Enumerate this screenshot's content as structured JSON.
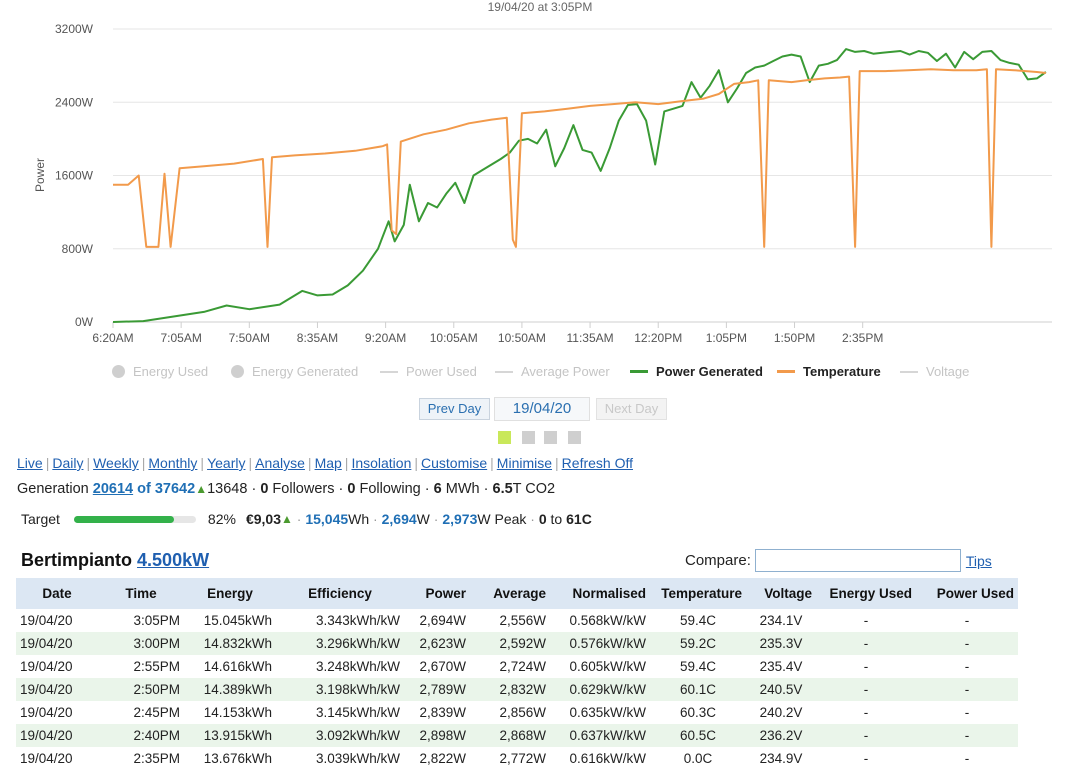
{
  "chart_data": {
    "type": "line",
    "title": "19/04/20 at 3:05PM",
    "ylabel": "Power",
    "ylim": [
      0,
      3200
    ],
    "yticks": [
      "0W",
      "800W",
      "1600W",
      "2400W",
      "3200W"
    ],
    "xticks": [
      "6:20AM",
      "7:05AM",
      "7:50AM",
      "8:35AM",
      "9:20AM",
      "10:05AM",
      "10:50AM",
      "11:35AM",
      "12:20PM",
      "1:05PM",
      "1:50PM",
      "2:35PM"
    ],
    "x_unit": "minutes after midnight",
    "grid": "horizontal",
    "legend_position": "bottom",
    "series": [
      {
        "name": "Power Generated",
        "color": "#3a9a35",
        "points": [
          [
            380,
            0
          ],
          [
            400,
            10
          ],
          [
            420,
            60
          ],
          [
            440,
            110
          ],
          [
            455,
            180
          ],
          [
            470,
            140
          ],
          [
            490,
            190
          ],
          [
            505,
            340
          ],
          [
            515,
            290
          ],
          [
            525,
            300
          ],
          [
            535,
            400
          ],
          [
            545,
            560
          ],
          [
            555,
            800
          ],
          [
            562,
            1100
          ],
          [
            566,
            880
          ],
          [
            572,
            1060
          ],
          [
            576,
            1500
          ],
          [
            582,
            1100
          ],
          [
            588,
            1300
          ],
          [
            594,
            1250
          ],
          [
            600,
            1400
          ],
          [
            606,
            1520
          ],
          [
            612,
            1300
          ],
          [
            618,
            1600
          ],
          [
            624,
            1660
          ],
          [
            630,
            1720
          ],
          [
            636,
            1780
          ],
          [
            642,
            1850
          ],
          [
            648,
            1980
          ],
          [
            654,
            2000
          ],
          [
            660,
            1950
          ],
          [
            666,
            2100
          ],
          [
            672,
            1700
          ],
          [
            678,
            1900
          ],
          [
            684,
            2150
          ],
          [
            690,
            1880
          ],
          [
            696,
            1850
          ],
          [
            702,
            1650
          ],
          [
            708,
            1900
          ],
          [
            714,
            2200
          ],
          [
            720,
            2370
          ],
          [
            726,
            2380
          ],
          [
            732,
            2200
          ],
          [
            738,
            1720
          ],
          [
            744,
            2300
          ],
          [
            750,
            2330
          ],
          [
            756,
            2360
          ],
          [
            762,
            2620
          ],
          [
            768,
            2450
          ],
          [
            774,
            2580
          ],
          [
            780,
            2750
          ],
          [
            786,
            2400
          ],
          [
            792,
            2550
          ],
          [
            798,
            2720
          ],
          [
            804,
            2780
          ],
          [
            810,
            2800
          ],
          [
            816,
            2850
          ],
          [
            822,
            2900
          ],
          [
            828,
            2920
          ],
          [
            834,
            2900
          ],
          [
            840,
            2620
          ],
          [
            846,
            2800
          ],
          [
            852,
            2820
          ],
          [
            858,
            2860
          ],
          [
            864,
            2980
          ],
          [
            870,
            2950
          ],
          [
            876,
            2960
          ],
          [
            882,
            2930
          ],
          [
            888,
            2940
          ],
          [
            894,
            2950
          ],
          [
            900,
            2960
          ],
          [
            906,
            2920
          ],
          [
            912,
            2960
          ],
          [
            918,
            2940
          ],
          [
            924,
            2850
          ],
          [
            930,
            2930
          ],
          [
            936,
            2780
          ],
          [
            942,
            2950
          ],
          [
            948,
            2870
          ],
          [
            954,
            2950
          ],
          [
            960,
            2960
          ],
          [
            966,
            2860
          ],
          [
            972,
            2830
          ],
          [
            978,
            2810
          ],
          [
            984,
            2650
          ],
          [
            990,
            2660
          ],
          [
            996,
            2730
          ]
        ]
      },
      {
        "name": "Temperature",
        "color": "#f29a4b",
        "points": [
          [
            380,
            1500
          ],
          [
            390,
            1500
          ],
          [
            397,
            1600
          ],
          [
            402,
            820
          ],
          [
            410,
            820
          ],
          [
            414,
            1620
          ],
          [
            418,
            820
          ],
          [
            424,
            1680
          ],
          [
            440,
            1700
          ],
          [
            460,
            1730
          ],
          [
            479,
            1780
          ],
          [
            482,
            820
          ],
          [
            485,
            1800
          ],
          [
            500,
            1820
          ],
          [
            520,
            1840
          ],
          [
            540,
            1870
          ],
          [
            558,
            1920
          ],
          [
            561,
            1940
          ],
          [
            564,
            1000
          ],
          [
            567,
            960
          ],
          [
            570,
            1970
          ],
          [
            585,
            2050
          ],
          [
            600,
            2100
          ],
          [
            615,
            2170
          ],
          [
            630,
            2210
          ],
          [
            640,
            2230
          ],
          [
            644,
            900
          ],
          [
            646,
            820
          ],
          [
            650,
            2280
          ],
          [
            665,
            2300
          ],
          [
            680,
            2330
          ],
          [
            695,
            2360
          ],
          [
            710,
            2380
          ],
          [
            725,
            2400
          ],
          [
            740,
            2380
          ],
          [
            755,
            2410
          ],
          [
            770,
            2440
          ],
          [
            780,
            2490
          ],
          [
            790,
            2600
          ],
          [
            800,
            2620
          ],
          [
            806,
            2640
          ],
          [
            810,
            820
          ],
          [
            813,
            2640
          ],
          [
            828,
            2620
          ],
          [
            838,
            2640
          ],
          [
            850,
            2660
          ],
          [
            860,
            2670
          ],
          [
            866,
            2680
          ],
          [
            870,
            820
          ],
          [
            873,
            2740
          ],
          [
            890,
            2740
          ],
          [
            905,
            2750
          ],
          [
            920,
            2760
          ],
          [
            935,
            2750
          ],
          [
            950,
            2750
          ],
          [
            957,
            2760
          ],
          [
            960,
            820
          ],
          [
            963,
            2760
          ],
          [
            975,
            2750
          ],
          [
            990,
            2730
          ],
          [
            996,
            2720
          ]
        ]
      }
    ]
  },
  "legend": [
    {
      "label": "Energy Used",
      "kind": "dot",
      "enabled": false
    },
    {
      "label": "Energy Generated",
      "kind": "dot",
      "enabled": false
    },
    {
      "label": "Power Used",
      "kind": "line",
      "enabled": false
    },
    {
      "label": "Average Power",
      "kind": "line",
      "enabled": false
    },
    {
      "label": "Power Generated",
      "kind": "line",
      "enabled": true,
      "color": "#3a9a35"
    },
    {
      "label": "Temperature",
      "kind": "line",
      "enabled": true,
      "color": "#f29a4b"
    },
    {
      "label": "Voltage",
      "kind": "line",
      "enabled": false
    }
  ],
  "daynav": {
    "prev": "Prev Day",
    "date": "19/04/20",
    "next": "Next Day"
  },
  "nav_links": [
    "Live",
    "Daily",
    "Weekly",
    "Monthly",
    "Yearly",
    "Analyse",
    "Map",
    "Insolation",
    "Customise",
    "Minimise",
    "Refresh Off"
  ],
  "generation": {
    "label": "Generation",
    "rank": "20614",
    "rank_of": "of 37642",
    "rank_change": "13648",
    "followers": "0",
    "followers_label": "Followers",
    "following": "0",
    "following_label": "Following",
    "energy": "6",
    "energy_unit": "MWh",
    "co2": "6.5",
    "co2_unit": "T CO2"
  },
  "target": {
    "label": "Target",
    "percent_value": 82,
    "percent": "82%",
    "money": "€9,03",
    "energy": "15,045",
    "energy_unit": "Wh",
    "power": "2,694",
    "power_unit": "W",
    "peak": "2,973",
    "peak_unit": "W Peak",
    "temp_from": "0",
    "temp_to_text": "to",
    "temp_to": "61C"
  },
  "system": {
    "name": "Bertimpianto",
    "size": "4.500kW"
  },
  "compare": {
    "label": "Compare:",
    "value": "",
    "tips": "Tips"
  },
  "table": {
    "headers": [
      "Date",
      "Time",
      "Energy",
      "Efficiency",
      "Power",
      "Average",
      "Normalised",
      "Temperature",
      "Voltage",
      "Energy Used",
      "Power Used"
    ],
    "rows": [
      [
        "19/04/20",
        "3:05PM",
        "15.045kWh",
        "3.343kWh/kW",
        "2,694W",
        "2,556W",
        "0.568kW/kW",
        "59.4C",
        "234.1V",
        "-",
        "-"
      ],
      [
        "19/04/20",
        "3:00PM",
        "14.832kWh",
        "3.296kWh/kW",
        "2,623W",
        "2,592W",
        "0.576kW/kW",
        "59.2C",
        "235.3V",
        "-",
        "-"
      ],
      [
        "19/04/20",
        "2:55PM",
        "14.616kWh",
        "3.248kWh/kW",
        "2,670W",
        "2,724W",
        "0.605kW/kW",
        "59.4C",
        "235.4V",
        "-",
        "-"
      ],
      [
        "19/04/20",
        "2:50PM",
        "14.389kWh",
        "3.198kWh/kW",
        "2,789W",
        "2,832W",
        "0.629kW/kW",
        "60.1C",
        "240.5V",
        "-",
        "-"
      ],
      [
        "19/04/20",
        "2:45PM",
        "14.153kWh",
        "3.145kWh/kW",
        "2,839W",
        "2,856W",
        "0.635kW/kW",
        "60.3C",
        "240.2V",
        "-",
        "-"
      ],
      [
        "19/04/20",
        "2:40PM",
        "13.915kWh",
        "3.092kWh/kW",
        "2,898W",
        "2,868W",
        "0.637kW/kW",
        "60.5C",
        "236.2V",
        "-",
        "-"
      ],
      [
        "19/04/20",
        "2:35PM",
        "13.676kWh",
        "3.039kWh/kW",
        "2,822W",
        "2,772W",
        "0.616kW/kW",
        "0.0C",
        "234.9V",
        "-",
        "-"
      ]
    ]
  }
}
